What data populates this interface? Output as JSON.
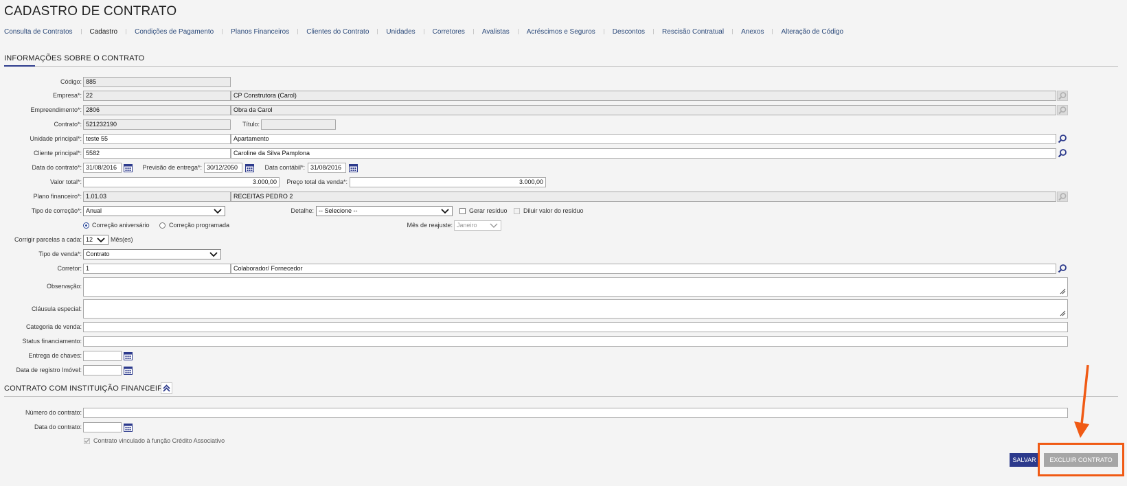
{
  "page_title": "CADASTRO DE CONTRATO",
  "tabs": [
    {
      "label": "Consulta de Contratos",
      "active": false
    },
    {
      "label": "Cadastro",
      "active": true
    },
    {
      "label": "Condições de Pagamento",
      "active": false
    },
    {
      "label": "Planos Financeiros",
      "active": false
    },
    {
      "label": "Clientes do Contrato",
      "active": false
    },
    {
      "label": "Unidades",
      "active": false
    },
    {
      "label": "Corretores",
      "active": false
    },
    {
      "label": "Avalistas",
      "active": false
    },
    {
      "label": "Acréscimos e Seguros",
      "active": false
    },
    {
      "label": "Descontos",
      "active": false
    },
    {
      "label": "Rescisão Contratual",
      "active": false
    },
    {
      "label": "Anexos",
      "active": false
    },
    {
      "label": "Alteração de Código",
      "active": false
    }
  ],
  "section_info": {
    "title": "INFORMAÇÕES SOBRE O CONTRATO",
    "codigo": {
      "label": "Código:",
      "value": "885"
    },
    "empresa": {
      "label": "Empresa*:",
      "code": "22",
      "name": "CP Construtora (Carol)"
    },
    "empreendimento": {
      "label": "Empreendimento*:",
      "code": "2806",
      "name": "Obra da Carol"
    },
    "contrato": {
      "label": "Contrato*:",
      "value": "521232190"
    },
    "titulo": {
      "label": "Título:",
      "value": ""
    },
    "unidade_principal": {
      "label": "Unidade principal*:",
      "code": "teste 55",
      "name": "Apartamento"
    },
    "cliente_principal": {
      "label": "Cliente principal*:",
      "code": "5582",
      "name": "Caroline da Silva Pamplona"
    },
    "data_contrato": {
      "label": "Data do contrato*:",
      "value": "31/08/2016"
    },
    "previsao_entrega": {
      "label": "Previsão de entrega*:",
      "value": "30/12/2050"
    },
    "data_contabil": {
      "label": "Data contábil*:",
      "value": "31/08/2016"
    },
    "valor_total": {
      "label": "Valor total*:",
      "value": "3.000,00"
    },
    "preco_total_venda": {
      "label": "Preço total da venda*:",
      "value": "3.000,00"
    },
    "plano_financeiro": {
      "label": "Plano financeiro*:",
      "code": "1.01.03",
      "name": "RECEITAS PEDRO 2"
    },
    "tipo_correcao": {
      "label": "Tipo de correção*:",
      "value": "Anual"
    },
    "detalhe": {
      "label": "Detalhe:",
      "value": "-- Selecione --"
    },
    "gerar_residuo": {
      "label": "Gerar resíduo",
      "checked": false
    },
    "diluir_residuo": {
      "label": "Diluir valor do resíduo",
      "checked": false
    },
    "correcao_aniversario": {
      "label": "Correção aniversário",
      "selected": true
    },
    "correcao_programada": {
      "label": "Correção programada",
      "selected": false
    },
    "mes_reajuste": {
      "label": "Mês de reajuste:",
      "value": "Janeiro"
    },
    "corrigir_parcelas": {
      "label": "Corrigir parcelas a cada:",
      "value": "12",
      "unit": "Mês(es)"
    },
    "tipo_venda": {
      "label": "Tipo de venda*:",
      "value": "Contrato"
    },
    "corretor": {
      "label": "Corretor:",
      "code": "1",
      "name": "Colaborador/ Fornecedor"
    },
    "observacao": {
      "label": "Observação:",
      "value": ""
    },
    "clausula_especial": {
      "label": "Cláusula especial:",
      "value": ""
    },
    "categoria_venda": {
      "label": "Categoria de venda:",
      "value": ""
    },
    "status_financiamento": {
      "label": "Status financiamento:",
      "value": ""
    },
    "entrega_chaves": {
      "label": "Entrega de chaves:",
      "value": ""
    },
    "data_registro_imovel": {
      "label": "Data de registro Imóvel:",
      "value": ""
    }
  },
  "section_financeira": {
    "title": "CONTRATO COM INSTITUIÇÃO FINANCEIRA",
    "numero_contrato": {
      "label": "Número do contrato:",
      "value": ""
    },
    "data_contrato": {
      "label": "Data do contrato:",
      "value": ""
    },
    "credito_associativo": {
      "label": "Contrato vinculado à função Crédito Associativo",
      "checked": true,
      "disabled": true
    }
  },
  "buttons": {
    "save": "SALVAR",
    "delete": "EXCLUIR CONTRATO"
  },
  "colors": {
    "accent": "#2c3a8c",
    "link": "#2c4a7a",
    "annotation": "#f05a14",
    "delete_button": "#a6a6a6"
  },
  "icons": [
    "search-icon",
    "calendar-icon",
    "chevron-down-icon",
    "collapse-up-icon",
    "arrow-down-icon",
    "resize-grip-icon"
  ]
}
